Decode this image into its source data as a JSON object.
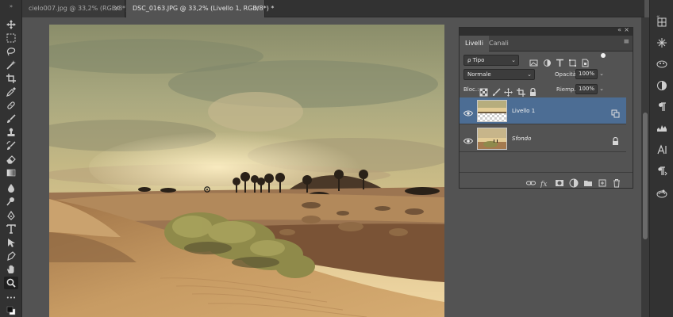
{
  "tabs": [
    {
      "label": "cielo007.jpg @ 33,2% (RGB/8*)",
      "close": "×",
      "active": false
    },
    {
      "label": "DSC_0163.JPG @ 33,2% (Livello 1, RGB/8*) *",
      "close": "×",
      "active": true
    }
  ],
  "toolbar": {
    "collapse": "»",
    "tools": [
      "move-icon",
      "marquee-icon",
      "lasso-icon",
      "magic-wand-icon",
      "crop-icon",
      "eyedropper-icon",
      "healing-icon",
      "brush-icon",
      "clone-stamp-icon",
      "history-brush-icon",
      "eraser-icon",
      "gradient-icon",
      "blur-icon",
      "dodge-icon",
      "pen-icon",
      "type-icon",
      "path-select-icon",
      "shape-icon",
      "hand-icon",
      "zoom-icon",
      "more-icon",
      "colors-icon"
    ],
    "selected": "zoom-icon",
    "more_label": "•••"
  },
  "layers_panel": {
    "collapse_label": "«",
    "close_label": "×",
    "tabs": [
      "Livelli",
      "Canali"
    ],
    "active_tab": "Livelli",
    "menu_icon": "panel-menu-icon",
    "filter": {
      "value": "ρ Tipo"
    },
    "blend_mode": {
      "value": "Normale"
    },
    "opacity": {
      "label": "Opacità:",
      "value": "100%"
    },
    "lock": {
      "label": "Bloc.:"
    },
    "fill": {
      "label": "Riemp.:",
      "value": "100%"
    },
    "layers": [
      {
        "name": "Livello 1",
        "selected": true,
        "visible": true,
        "badge": "smart-link-icon"
      },
      {
        "name": "Sfondo",
        "selected": false,
        "visible": true,
        "italic": true,
        "badge": "lock-icon"
      }
    ],
    "footer": [
      "link-layers-icon",
      "fx-icon",
      "add-mask-icon",
      "adjustment-icon",
      "group-icon",
      "new-layer-icon",
      "trash-icon"
    ]
  },
  "dock": [
    "color-icon",
    "swatches-icon",
    "adjustments-icon",
    "properties-icon",
    "paragraph-icon",
    "histogram-icon",
    "character-icon",
    "paragraph-styles-icon",
    "libraries-icon"
  ],
  "colors": {
    "panel_bg": "#535353",
    "selected_layer": "#4c6d94",
    "chrome": "#323232"
  }
}
